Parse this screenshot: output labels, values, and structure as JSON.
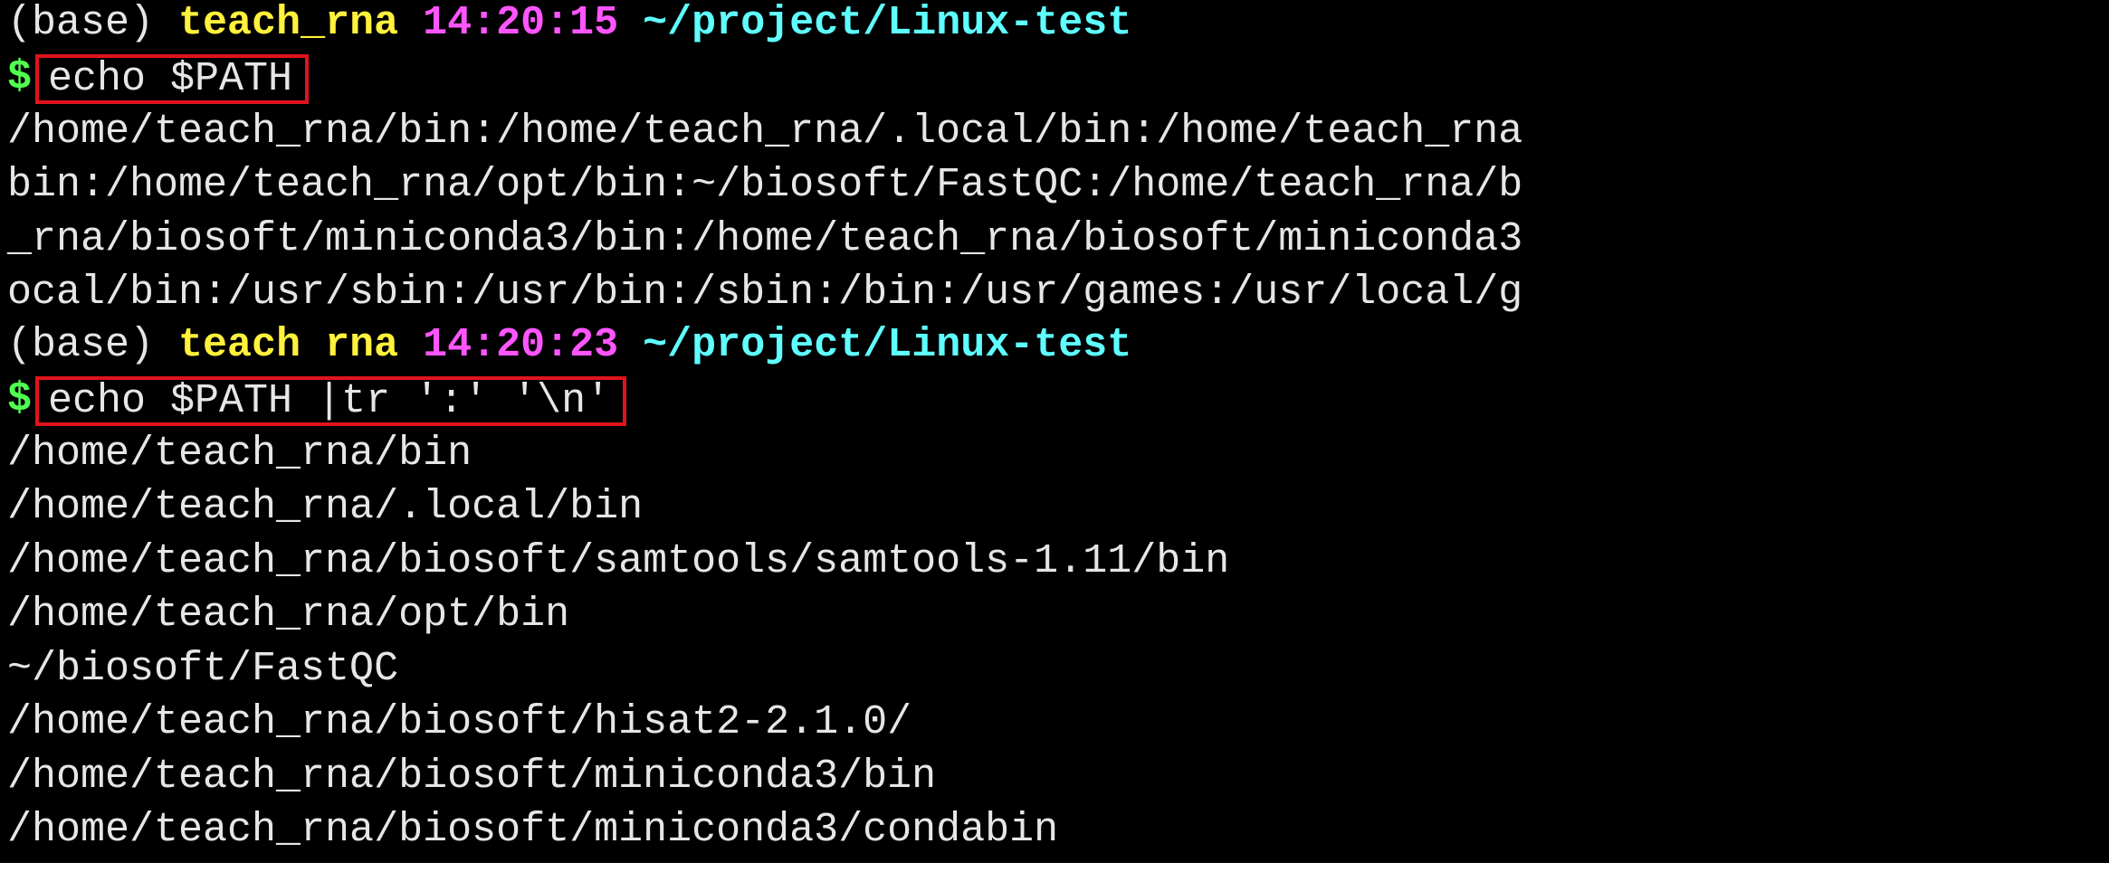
{
  "prompts": [
    {
      "env": "(base)",
      "user": "teach_rna",
      "time": "14:20:15",
      "cwd": "~/project/Linux-test",
      "symbol": "$",
      "command": "echo $PATH"
    },
    {
      "env": "(base)",
      "user": "teach rna",
      "time": "14:20:23",
      "cwd": "~/project/Linux-test",
      "symbol": "$",
      "command": "echo $PATH |tr ':' '\\n'"
    }
  ],
  "output_block_1": [
    "/home/teach_rna/bin:/home/teach_rna/.local/bin:/home/teach_rna",
    "bin:/home/teach_rna/opt/bin:~/biosoft/FastQC:/home/teach_rna/b",
    "_rna/biosoft/miniconda3/bin:/home/teach_rna/biosoft/miniconda3",
    "ocal/bin:/usr/sbin:/usr/bin:/sbin:/bin:/usr/games:/usr/local/g"
  ],
  "output_block_2": [
    "/home/teach_rna/bin",
    "/home/teach_rna/.local/bin",
    "/home/teach_rna/biosoft/samtools/samtools-1.11/bin",
    "/home/teach_rna/opt/bin",
    "~/biosoft/FastQC",
    "/home/teach_rna/biosoft/hisat2-2.1.0/",
    "/home/teach_rna/biosoft/miniconda3/bin",
    "/home/teach_rna/biosoft/miniconda3/condabin"
  ],
  "colors": {
    "background": "#000000",
    "text": "#e6e6e6",
    "user": "#fff13c",
    "time": "#ff55ff",
    "cwd": "#5fffff",
    "prompt_symbol": "#50ff50",
    "highlight_box": "#e0141e"
  }
}
